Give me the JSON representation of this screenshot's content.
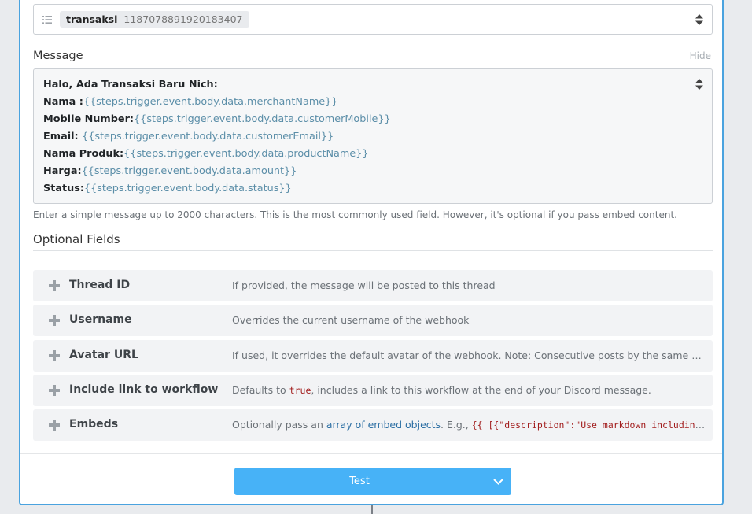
{
  "step_select": {
    "tag_name": "transaksi",
    "tag_value": "1187078891920183407"
  },
  "message": {
    "label": "Message",
    "hide_label": "Hide",
    "lines": [
      {
        "key": "Halo, Ada Transaksi Baru Nich:",
        "value": ""
      },
      {
        "key": "Nama :",
        "value": "{{steps.trigger.event.body.data.merchantName}}"
      },
      {
        "key": "Mobile Number:",
        "value": "{{steps.trigger.event.body.data.customerMobile}}"
      },
      {
        "key": "Email: ",
        "value": "{{steps.trigger.event.body.data.customerEmail}}"
      },
      {
        "key": "Nama Produk:",
        "value": "{{steps.trigger.event.body.data.productName}}"
      },
      {
        "key": "Harga:",
        "value": "{{steps.trigger.event.body.data.amount}}"
      },
      {
        "key": "Status:",
        "value": "{{steps.trigger.event.body.data.status}}"
      }
    ],
    "help": "Enter a simple message up to 2000 characters. This is the most commonly used field. However, it's optional if you pass embed content."
  },
  "optional_fields": {
    "title": "Optional Fields",
    "rows": [
      {
        "name": "Thread ID",
        "desc": "If provided, the message will be posted to this thread"
      },
      {
        "name": "Username",
        "desc": "Overrides the current username of the webhook"
      },
      {
        "name": "Avatar URL",
        "desc": "If used, it overrides the default avatar of the webhook. Note: Consecutive posts by the same user..."
      },
      {
        "name": "Include link to workflow",
        "desc_pre": "Defaults to ",
        "desc_code": "true",
        "desc_post": ", includes a link to this workflow at the end of your Discord message."
      },
      {
        "name": "Embeds",
        "desc_pre": "Optionally pass an ",
        "desc_link": "array of embed objects",
        "desc_mid": ". E.g., ",
        "desc_code": "{{ [{\"description\":\"Use markdown including ..."
      }
    ]
  },
  "footer": {
    "test_label": "Test"
  }
}
